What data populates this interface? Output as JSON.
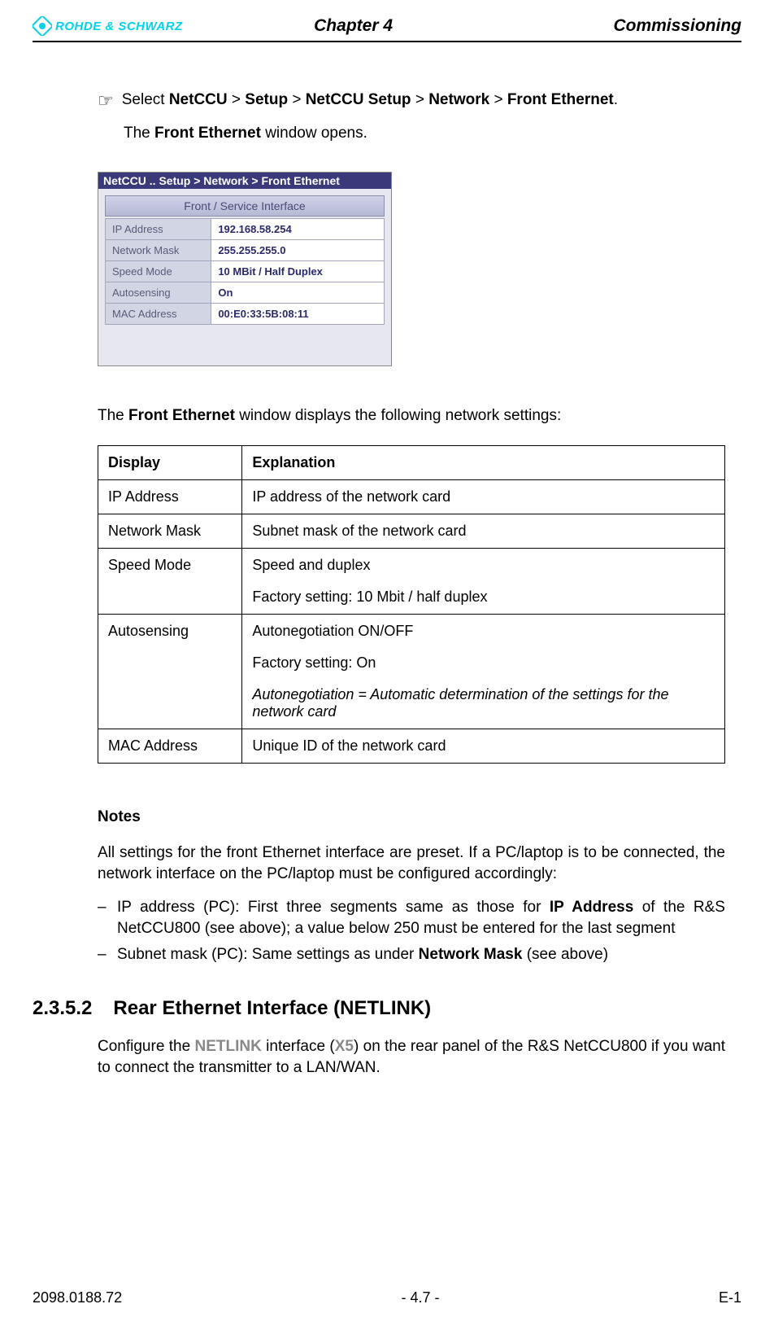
{
  "header": {
    "logo_text": "ROHDE & SCHWARZ",
    "chapter": "Chapter 4",
    "title": "Commissioning"
  },
  "instruction": {
    "prefix": "Select ",
    "b1": "NetCCU",
    "gt1": " > ",
    "b2": "Setup",
    "gt2": " > ",
    "b3": "NetCCU Setup",
    "gt3": " > ",
    "b4": "Network",
    "gt4": " > ",
    "b5": "Front Ethernet",
    "suffix": ".",
    "line2a": "The ",
    "line2b": "Front Ethernet",
    "line2c": " window opens."
  },
  "screenshot": {
    "titlebar": "NetCCU .. Setup > Network > Front Ethernet",
    "banner": "Front / Service Interface",
    "rows": [
      {
        "label": "IP Address",
        "value": "192.168.58.254"
      },
      {
        "label": "Network Mask",
        "value": "255.255.255.0"
      },
      {
        "label": "Speed Mode",
        "value": "10 MBit / Half Duplex"
      },
      {
        "label": "Autosensing",
        "value": "On"
      },
      {
        "label": "MAC Address",
        "value": "00:E0:33:5B:08:11"
      }
    ]
  },
  "caption": {
    "a": "The ",
    "b": "Front Ethernet",
    "c": " window displays the following network settings:"
  },
  "table": {
    "head1": "Display",
    "head2": "Explanation",
    "r1c1": "IP Address",
    "r1c2": "IP address of the network card",
    "r2c1": "Network Mask",
    "r2c2": "Subnet mask of the network card",
    "r3c1": "Speed Mode",
    "r3c2a": "Speed and duplex",
    "r3c2b": "Factory setting: 10 Mbit / half duplex",
    "r4c1": "Autosensing",
    "r4c2a": "Autonegotiation ON/OFF",
    "r4c2b": "Factory setting: On",
    "r4c2c": "Autonegotiation = Automatic determination of the settings for the network card",
    "r5c1": "MAC Address",
    "r5c2": "Unique ID of the network card"
  },
  "notes": {
    "heading": "Notes",
    "p1": "All settings for the front Ethernet interface are preset. If a PC/laptop is to be connected, the network interface on the PC/laptop must be configured accordingly:",
    "li1a": "IP address (PC): First three segments same as those for ",
    "li1b": "IP Address",
    "li1c": " of the R&S NetCCU800 (see above); a value below 250 must be entered for the last segment",
    "li2a": "Subnet mask (PC): Same settings as under ",
    "li2b": "Network Mask",
    "li2c": " (see above)"
  },
  "section": {
    "num": "2.3.5.2",
    "title": "Rear Ethernet Interface (NETLINK)",
    "p_a": "Configure the ",
    "p_b": "NETLINK",
    "p_c": " interface (",
    "p_d": "X5",
    "p_e": ") on the rear panel of the R&S NetCCU800 if you want to connect the transmitter to a LAN/WAN."
  },
  "footer": {
    "left": "2098.0188.72",
    "center": "- 4.7 -",
    "right": "E-1"
  }
}
